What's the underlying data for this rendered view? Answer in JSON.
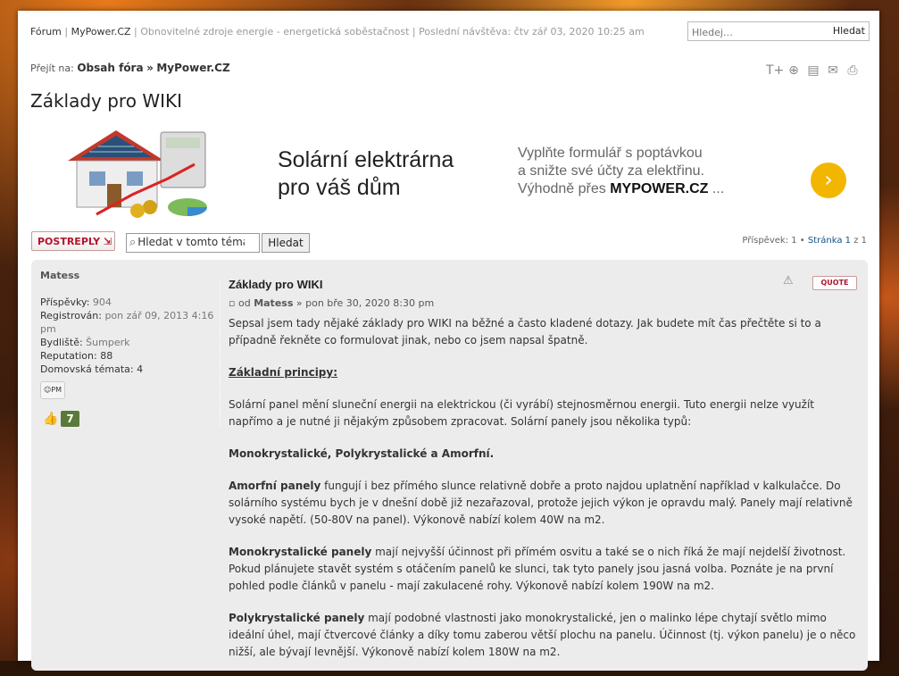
{
  "header": {
    "forum": "Fórum",
    "site": "MyPower.CZ",
    "tagline": "Obnovitelné zdroje energie - energetická soběstačnost",
    "last_visit": "Poslední návštěva: čtv zář 03, 2020 10:25 am",
    "search_placeholder": "Hledej…",
    "search_button": "Hledat"
  },
  "breadcrumb": {
    "prefix": "Přejít na:",
    "item1": "Obsah fóra",
    "sep": "»",
    "item2": "MyPower.CZ"
  },
  "page_title": "Základy pro WIKI",
  "banner": {
    "headline1": "Solární elektrárna",
    "headline2": "pro váš dům",
    "text1": "Vyplňte formulář s poptávkou",
    "text2": "a snižte své účty za elektřinu.",
    "text3_prefix": "Výhodně přes",
    "text3_brand": "MYPOWER.CZ",
    "text3_suffix": "...",
    "button": "›"
  },
  "topic_toolbar": {
    "postreply": "POSTREPLY",
    "search_value": "Hledat v tomto téma",
    "search_button": "Hledat",
    "pagination_prefix": "Příspěvek: 1 •",
    "pagination_link": "Stránka 1",
    "pagination_suffix": "z 1"
  },
  "post": {
    "author": "Matess",
    "profile": [
      {
        "label": "Příspěvky:",
        "value": "904"
      },
      {
        "label": "Registrován:",
        "value": "pon zář 09, 2013 4:16 pm"
      },
      {
        "label": "Bydliště:",
        "value": "Šumperk"
      },
      {
        "label": "Reputation:",
        "value": "88"
      },
      {
        "label": "Domovská témata:",
        "value": "4"
      }
    ],
    "pm_button": "PM",
    "karma": "7",
    "title": "Základy pro WIKI",
    "meta_prefix": "od",
    "meta_author": "Matess",
    "meta_date": "» pon bře 30, 2020 8:30 pm",
    "quote_button": "QUOTE",
    "intro": "Sepsal jsem tady nějaké základy pro WIKI na běžné a často kladené dotazy. Jak budete mít čas přečtěte si to a případně řekněte co formulovat jinak, nebo co jsem napsal špatně.",
    "section_title": "Základní principy:",
    "p1": "Solární panel mění sluneční energii na elektrickou (či vyrábí) stejnosměrnou energii. Tuto energii nelze využít napřímo a je nutné ji nějakým způsobem zpracovat. Solární panely jsou několika typů:",
    "types": "Monokrystalické, Polykrystalické a Amorfní.",
    "amorf_b": "Amorfní panely",
    "amorf_t": " fungují i bez přímého slunce relativně dobře a proto najdou uplatnění například v kalkulačce. Do solárního systému bych je v dnešní době již nezařazoval, protože jejich výkon je opravdu malý. Panely mají relativně vysoké napětí. (50-80V na panel). Výkonově nabízí kolem 40W na m2.",
    "mono_b": "Monokrystalické panely",
    "mono_t": " mají nejvyšší účinnost při přímém osvitu a také se o nich říká že mají nejdelší životnost. Pokud plánujete stavět systém s otáčením panelů ke slunci, tak tyto panely jsou jasná volba. Poznáte je na první pohled podle článků v panelu - mají zakulacené rohy. Výkonově nabízí kolem 190W na m2.",
    "poly_b": "Polykrystalické panely",
    "poly_t": " mají podobné vlastnosti jako monokrystalické, jen o malinko lépe chytají světlo mimo ideální úhel, mají čtvercové články a díky tomu zaberou větší plochu na panelu. Účinnost (tj. výkon panelu) je o něco nižší, ale bývají levnější. Výkonově nabízí kolem 180W na m2."
  },
  "colors": {
    "accent_red": "#b4142c",
    "link_blue": "#105289",
    "post_bg": "#ececec",
    "button_yellow": "#f2b600"
  }
}
